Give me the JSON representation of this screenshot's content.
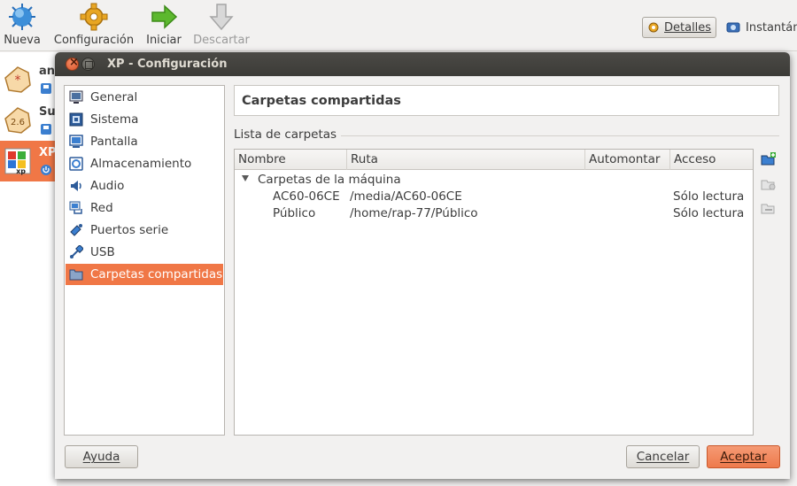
{
  "toolbar": {
    "new_label": "Nueva",
    "settings_label": "Configuración",
    "start_label": "Iniciar",
    "discard_label": "Descartar",
    "details_label": "Detalles",
    "snapshots_label": "Instantán"
  },
  "vm_list": [
    {
      "name": "an",
      "os_badge": "*",
      "state_icon": "saved-icon"
    },
    {
      "name": "Su",
      "os_badge": "2.6",
      "state_icon": "saved-icon"
    },
    {
      "name": "XP",
      "os_badge": "xp",
      "state_icon": "power-icon",
      "selected": true
    }
  ],
  "dialog": {
    "title": "XP - Configuración",
    "categories": [
      {
        "label": "General",
        "icon": "monitor-icon"
      },
      {
        "label": "Sistema",
        "icon": "chip-icon"
      },
      {
        "label": "Pantalla",
        "icon": "display-icon"
      },
      {
        "label": "Almacenamiento",
        "icon": "storage-icon"
      },
      {
        "label": "Audio",
        "icon": "speaker-icon"
      },
      {
        "label": "Red",
        "icon": "network-icon"
      },
      {
        "label": "Puertos serie",
        "icon": "serial-port-icon"
      },
      {
        "label": "USB",
        "icon": "usb-icon"
      },
      {
        "label": "Carpetas compartidas",
        "icon": "folder-icon",
        "selected": true
      }
    ],
    "pane_title": "Carpetas compartidas",
    "list_label": "Lista de carpetas",
    "columns": [
      "Nombre",
      "Ruta",
      "Automontar",
      "Acceso"
    ],
    "group_label": "Carpetas de la máquina",
    "rows": [
      {
        "name": "AC60-06CE",
        "path": "/media/AC60-06CE",
        "automount": "",
        "access": "Sólo lectura"
      },
      {
        "name": "Público",
        "path": "/home/rap-77/Público",
        "automount": "",
        "access": "Sólo lectura"
      }
    ],
    "help_label": "Ayuda",
    "cancel_label": "Cancelar",
    "ok_label": "Aceptar"
  },
  "colors": {
    "accent": "#f07746",
    "titlebar": "#3c3b37"
  }
}
